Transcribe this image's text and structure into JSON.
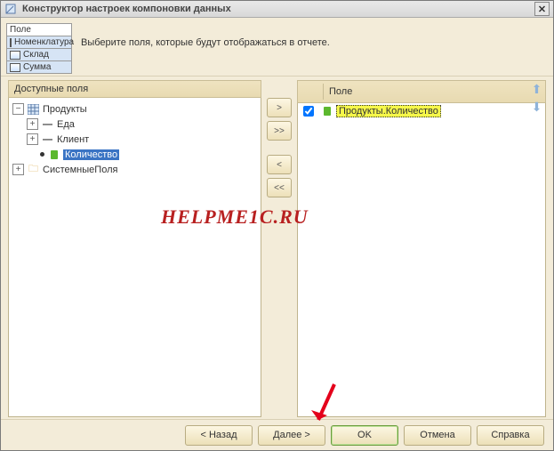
{
  "title": "Конструктор настроек компоновки данных",
  "headers_box": {
    "items": [
      {
        "label": "Поле",
        "selected": false
      },
      {
        "label": "Номенклатура",
        "selected": true
      },
      {
        "label": "Склад",
        "selected": true
      },
      {
        "label": "Сумма",
        "selected": true
      }
    ]
  },
  "instruction": "Выберите поля, которые будут отображаться в отчете.",
  "left_pane": {
    "header": "Доступные поля",
    "tree": [
      {
        "label": "Продукты",
        "level": 0,
        "expander": "−",
        "icon": "table"
      },
      {
        "label": "Еда",
        "level": 1,
        "expander": "+",
        "icon": "dash"
      },
      {
        "label": "Клиент",
        "level": 1,
        "expander": "+",
        "icon": "dash"
      },
      {
        "label": "Количество",
        "level": 1,
        "expander": "",
        "icon": "green",
        "selected": true,
        "bullet": true
      },
      {
        "label": "СистемныеПоля",
        "level": 0,
        "expander": "+",
        "icon": "folder"
      }
    ]
  },
  "move_buttons": {
    "right": ">",
    "right_all": ">>",
    "left": "<",
    "left_all": "<<"
  },
  "right_pane": {
    "header": "Поле",
    "rows": [
      {
        "label": "Продукты.Количество",
        "checked": true
      }
    ]
  },
  "watermark": "HELPME1C.RU",
  "footer": {
    "back": "< Назад",
    "next": "Далее >",
    "ok": "OK",
    "cancel": "Отмена",
    "help": "Справка"
  }
}
